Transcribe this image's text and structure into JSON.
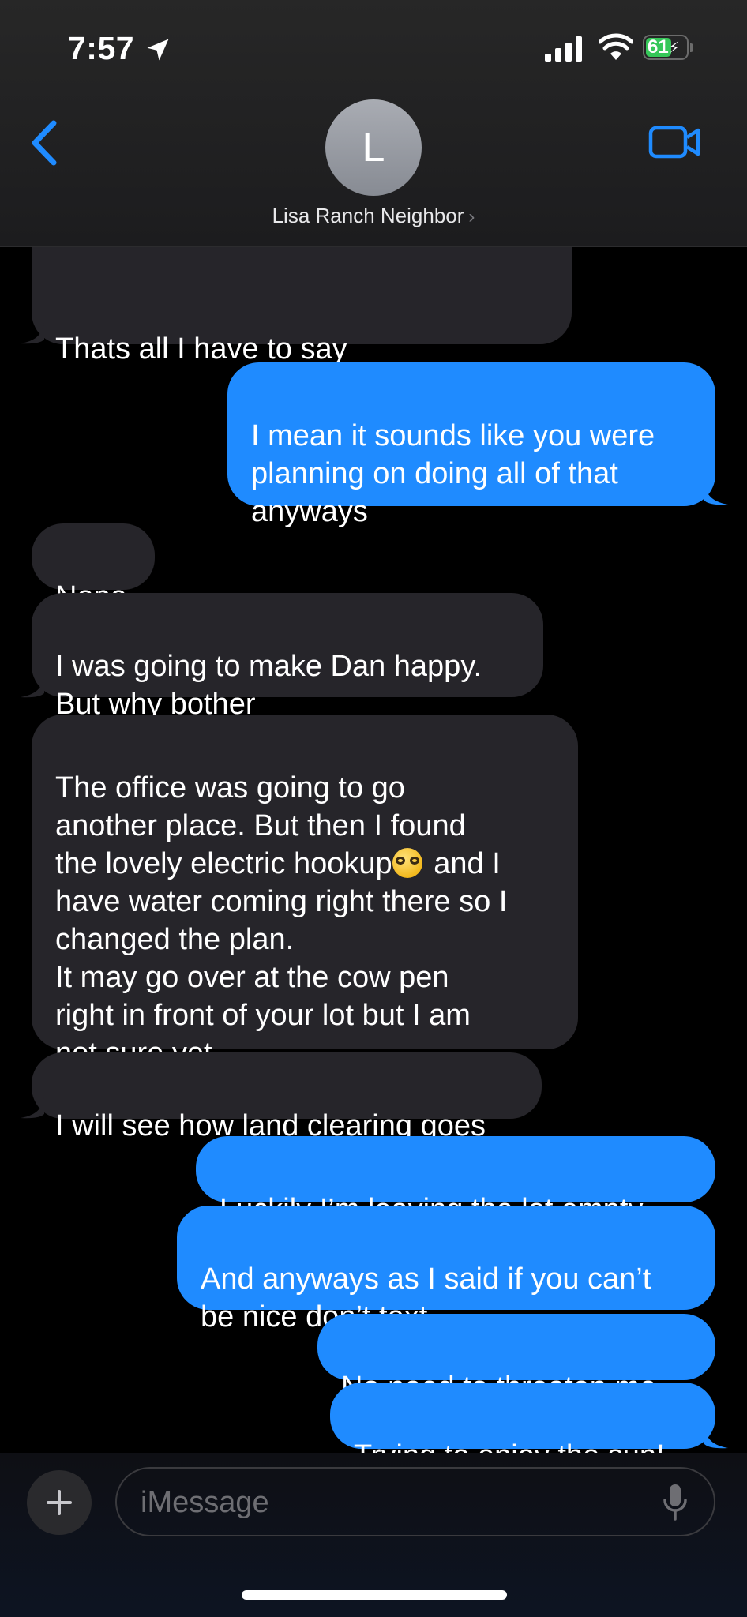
{
  "status_bar": {
    "time": "7:57",
    "battery": "61"
  },
  "header": {
    "avatar_initial": "L",
    "contact_name": "Lisa Ranch Neighbor",
    "accent_color": "#1f8bff"
  },
  "messages": [
    {
      "sender": "them",
      "text": "Thats all I have to say"
    },
    {
      "sender": "me",
      "text": "I mean it sounds like you were\nplanning on doing all of that\nanyways"
    },
    {
      "sender": "them",
      "text": "Nope"
    },
    {
      "sender": "them",
      "text": "I was going to make Dan happy.\nBut why bother"
    },
    {
      "sender": "them",
      "text_before_emoji": "The office was going to go\nanother place. But then I found\nthe lovely electric hookup",
      "emoji": "nerd-face-emoji",
      "text_after_emoji": " and I\nhave water coming right there so I\nchanged the plan.\nIt may go over at the cow pen\nright in front of your lot but I am\nnot sure yet"
    },
    {
      "sender": "them",
      "text": "I will see how land clearing goes"
    },
    {
      "sender": "me",
      "text": "Luckily I’m leaving the lot empty"
    },
    {
      "sender": "me",
      "text": "And anyways as I said if you can’t\nbe nice don’t text"
    },
    {
      "sender": "me",
      "text": "No need to threaten me"
    },
    {
      "sender": "me",
      "text": "Trying to enjoy the sun!"
    }
  ],
  "composer": {
    "placeholder": "iMessage"
  }
}
